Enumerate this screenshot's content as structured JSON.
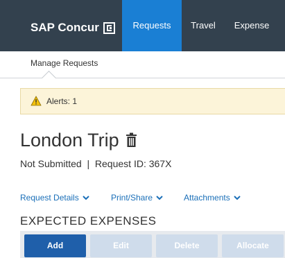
{
  "app": {
    "brand": "SAP Concur",
    "brand_mark_icon": "concur-logo-icon",
    "nav_tabs": [
      {
        "label": "Requests",
        "active": true
      },
      {
        "label": "Travel",
        "active": false
      },
      {
        "label": "Expense",
        "active": false
      }
    ],
    "active_color": "#1a7fd4",
    "bar_color": "#33414e"
  },
  "subnav": {
    "items": [
      {
        "label": "Manage Requests"
      }
    ]
  },
  "alert": {
    "icon": "warning-icon",
    "text": "Alerts: 1"
  },
  "request": {
    "title": "London Trip",
    "delete_icon": "trash-icon",
    "status_line": "Not Submitted  |  Request ID: 367X"
  },
  "links": {
    "details": "Request Details",
    "print": "Print/Share",
    "attachments": "Attachments"
  },
  "expected": {
    "heading": "EXPECTED EXPENSES",
    "buttons": {
      "add": "Add",
      "edit": "Edit",
      "delete": "Delete",
      "allocate": "Allocate"
    }
  }
}
